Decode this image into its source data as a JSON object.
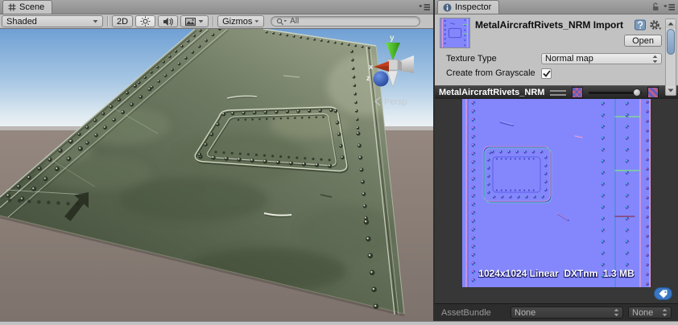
{
  "colors": {
    "panel_bg": "#c2c2c2",
    "preview_bg": "#373737",
    "normal_map_base": "#8487fb",
    "accent_blue": "#3a76c4",
    "axis_x_red": "#c4401f",
    "axis_y_green": "#52c32e",
    "axis_z_blue": "#2a55b0"
  },
  "scene": {
    "tab": "Scene",
    "toolbar": {
      "shading": "Shaded",
      "mode_2d": "2D",
      "gizmos": "Gizmos",
      "search_value": "All"
    },
    "gizmo": {
      "x": "x",
      "y": "y",
      "z": "z",
      "projection": "Persp"
    }
  },
  "inspector": {
    "tab": "Inspector",
    "header": {
      "title": "MetalAircraftRivets_NRM Import",
      "open": "Open"
    },
    "settings": {
      "texture_type_label": "Texture Type",
      "texture_type_value": "Normal map",
      "grayscale_label": "Create from Grayscale",
      "grayscale_checked": true
    },
    "preview": {
      "title": "MetalAircraftRivets_NRM",
      "info": "1024x1024 Linear  DXTnm  1.3 MB"
    },
    "asset_bundle": {
      "label": "AssetBundle",
      "bundle": "None",
      "variant": "None"
    }
  }
}
